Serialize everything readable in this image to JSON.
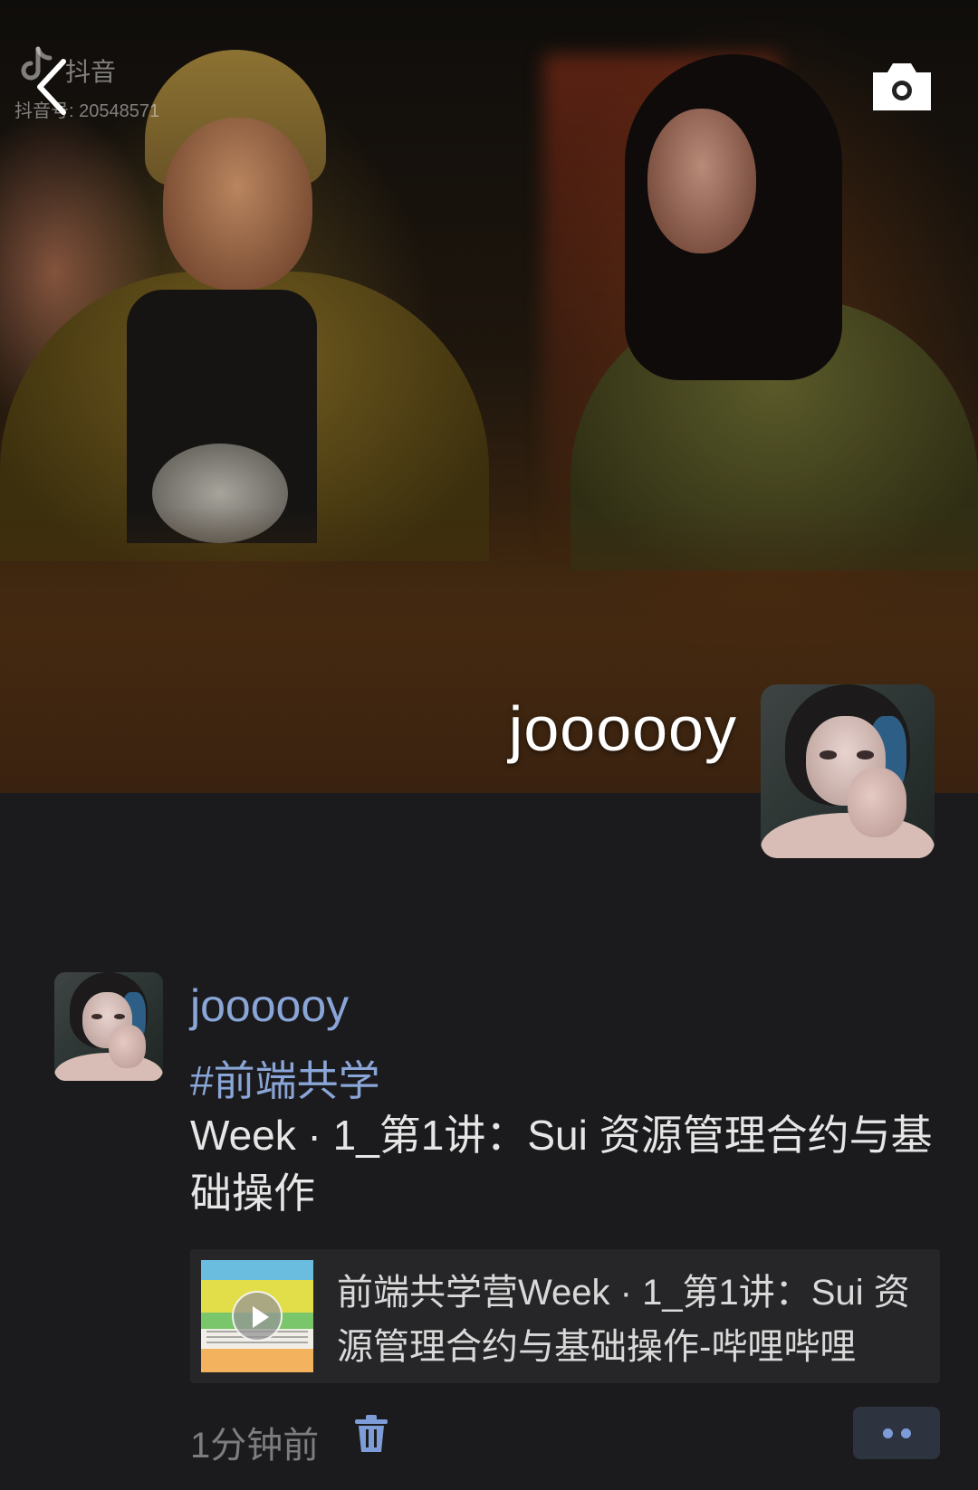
{
  "cover": {
    "watermark_brand": "抖音",
    "watermark_id": "抖音号: 20548571",
    "username": "joooooy"
  },
  "icons": {
    "back": "chevron-left-icon",
    "camera": "camera-icon",
    "delete": "trash-icon",
    "more": "more-dots-icon",
    "play": "play-icon"
  },
  "post": {
    "author": "joooooy",
    "hashtag": "#前端共学",
    "text": "Week · 1_第1讲：Sui 资源管理合约与基础操作",
    "link_card": {
      "title": "前端共学营Week · 1_第1讲：Sui 资源管理合约与基础操作-哔哩哔哩"
    },
    "time": "1分钟前"
  },
  "colors": {
    "background": "#1b1b1d",
    "link_blue": "#8aa6d8",
    "card_bg": "#262628",
    "more_button_bg": "#2e3340"
  }
}
